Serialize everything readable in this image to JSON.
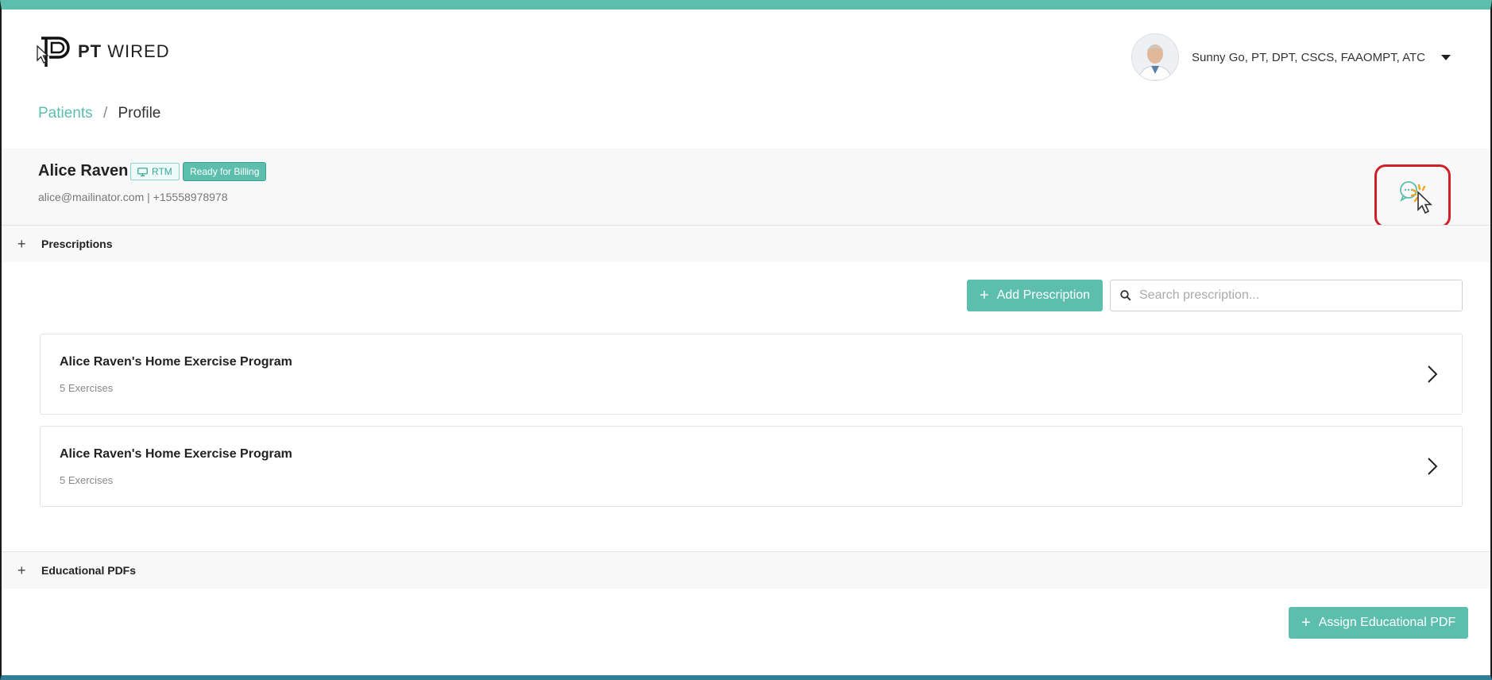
{
  "header": {
    "logo_bold": "PT",
    "logo_light": "WIRED",
    "user_name": "Sunny Go, PT, DPT, CSCS, FAAOMPT, ATC"
  },
  "breadcrumb": {
    "link": "Patients",
    "separator": "/",
    "current": "Profile"
  },
  "patient": {
    "name": "Alice Raven",
    "badge_rtm": "RTM",
    "badge_status": "Ready for Billing",
    "contact": "alice@mailinator.com | +15558978978"
  },
  "prescriptions": {
    "section_title": "Prescriptions",
    "add_button": "Add Prescription",
    "search_placeholder": "Search prescription...",
    "items": [
      {
        "title": "Alice Raven's Home Exercise Program",
        "subtitle": "5 Exercises"
      },
      {
        "title": "Alice Raven's Home Exercise Program",
        "subtitle": "5 Exercises"
      }
    ]
  },
  "educational": {
    "section_title": "Educational PDFs",
    "assign_button": "Assign Educational PDF"
  },
  "colors": {
    "accent": "#5cbfae",
    "highlight": "#d01f27",
    "top_bar": "#5cbfae"
  },
  "icons": [
    "logo-p-icon",
    "chevron-down-icon",
    "monitor-icon",
    "chat-icon",
    "plus-icon",
    "search-icon",
    "chevron-right-icon",
    "cursor-icon"
  ]
}
